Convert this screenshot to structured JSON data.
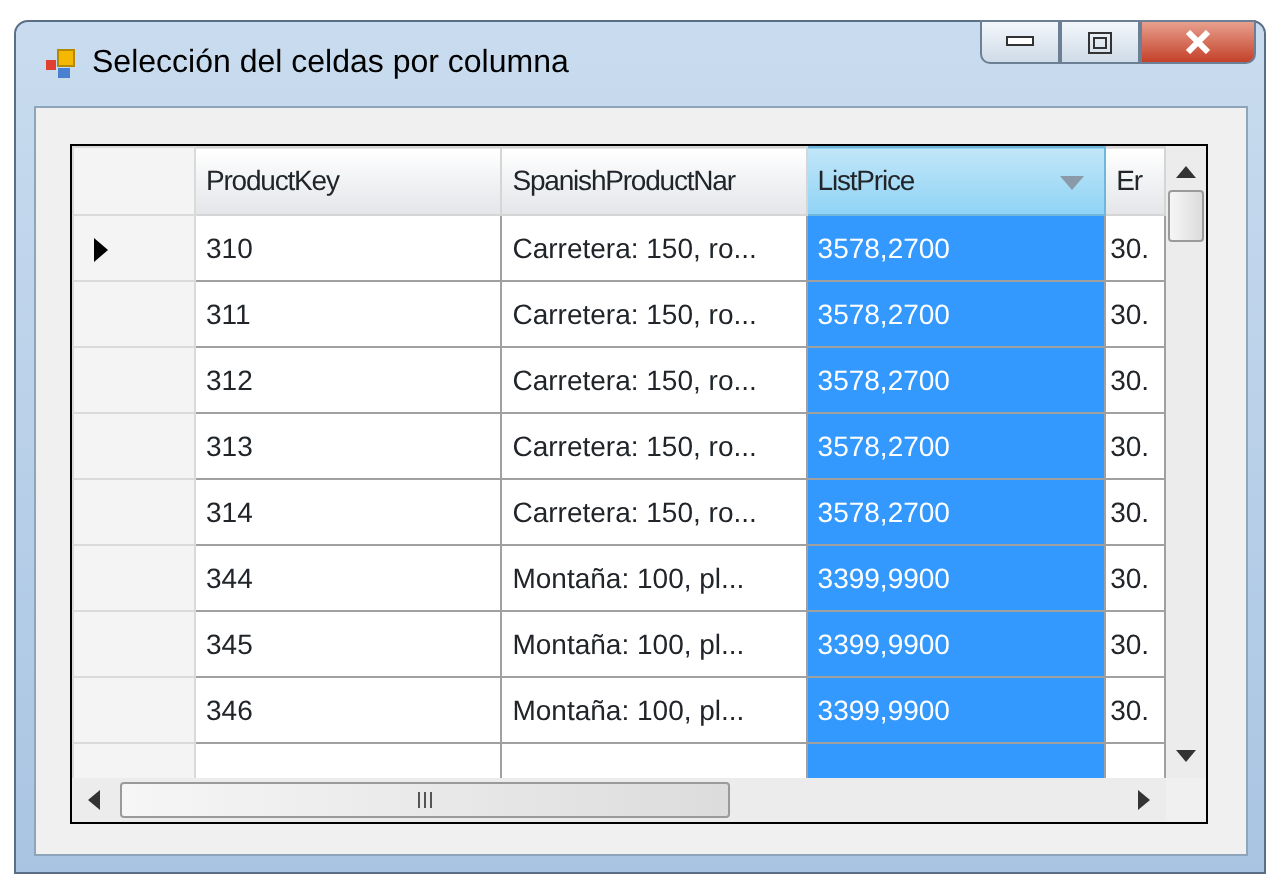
{
  "window": {
    "title": "Selección del celdas por columna"
  },
  "table": {
    "columns": [
      {
        "label": "ProductKey",
        "selected": false,
        "sort_arrow": false
      },
      {
        "label": "SpanishProductNar",
        "selected": false,
        "sort_arrow": false
      },
      {
        "label": "ListPrice",
        "selected": true,
        "sort_arrow": true
      },
      {
        "label": "Er",
        "selected": false,
        "sort_arrow": false
      }
    ],
    "rows": [
      {
        "current": true,
        "cells": [
          {
            "text": "310",
            "selected": false
          },
          {
            "text": "Carretera: 150, ro...",
            "selected": false
          },
          {
            "text": "3578,2700",
            "selected": true
          },
          {
            "text": "30.",
            "selected": false
          }
        ]
      },
      {
        "current": false,
        "cells": [
          {
            "text": "311",
            "selected": false
          },
          {
            "text": "Carretera: 150, ro...",
            "selected": false
          },
          {
            "text": "3578,2700",
            "selected": true
          },
          {
            "text": "30.",
            "selected": false
          }
        ]
      },
      {
        "current": false,
        "cells": [
          {
            "text": "312",
            "selected": false
          },
          {
            "text": "Carretera: 150, ro...",
            "selected": false
          },
          {
            "text": "3578,2700",
            "selected": true
          },
          {
            "text": "30.",
            "selected": false
          }
        ]
      },
      {
        "current": false,
        "cells": [
          {
            "text": "313",
            "selected": false
          },
          {
            "text": "Carretera: 150, ro...",
            "selected": false
          },
          {
            "text": "3578,2700",
            "selected": true
          },
          {
            "text": "30.",
            "selected": false
          }
        ]
      },
      {
        "current": false,
        "cells": [
          {
            "text": "314",
            "selected": false
          },
          {
            "text": "Carretera: 150, ro...",
            "selected": false
          },
          {
            "text": "3578,2700",
            "selected": true
          },
          {
            "text": "30.",
            "selected": false
          }
        ]
      },
      {
        "current": false,
        "cells": [
          {
            "text": "344",
            "selected": false
          },
          {
            "text": "Montaña: 100, pl...",
            "selected": false
          },
          {
            "text": "3399,9900",
            "selected": true
          },
          {
            "text": "30.",
            "selected": false
          }
        ]
      },
      {
        "current": false,
        "cells": [
          {
            "text": "345",
            "selected": false
          },
          {
            "text": "Montaña: 100, pl...",
            "selected": false
          },
          {
            "text": "3399,9900",
            "selected": true
          },
          {
            "text": "30.",
            "selected": false
          }
        ]
      },
      {
        "current": false,
        "cells": [
          {
            "text": "346",
            "selected": false
          },
          {
            "text": "Montaña: 100, pl...",
            "selected": false
          },
          {
            "text": "3399,9900",
            "selected": true
          },
          {
            "text": "30.",
            "selected": false
          }
        ]
      }
    ]
  }
}
